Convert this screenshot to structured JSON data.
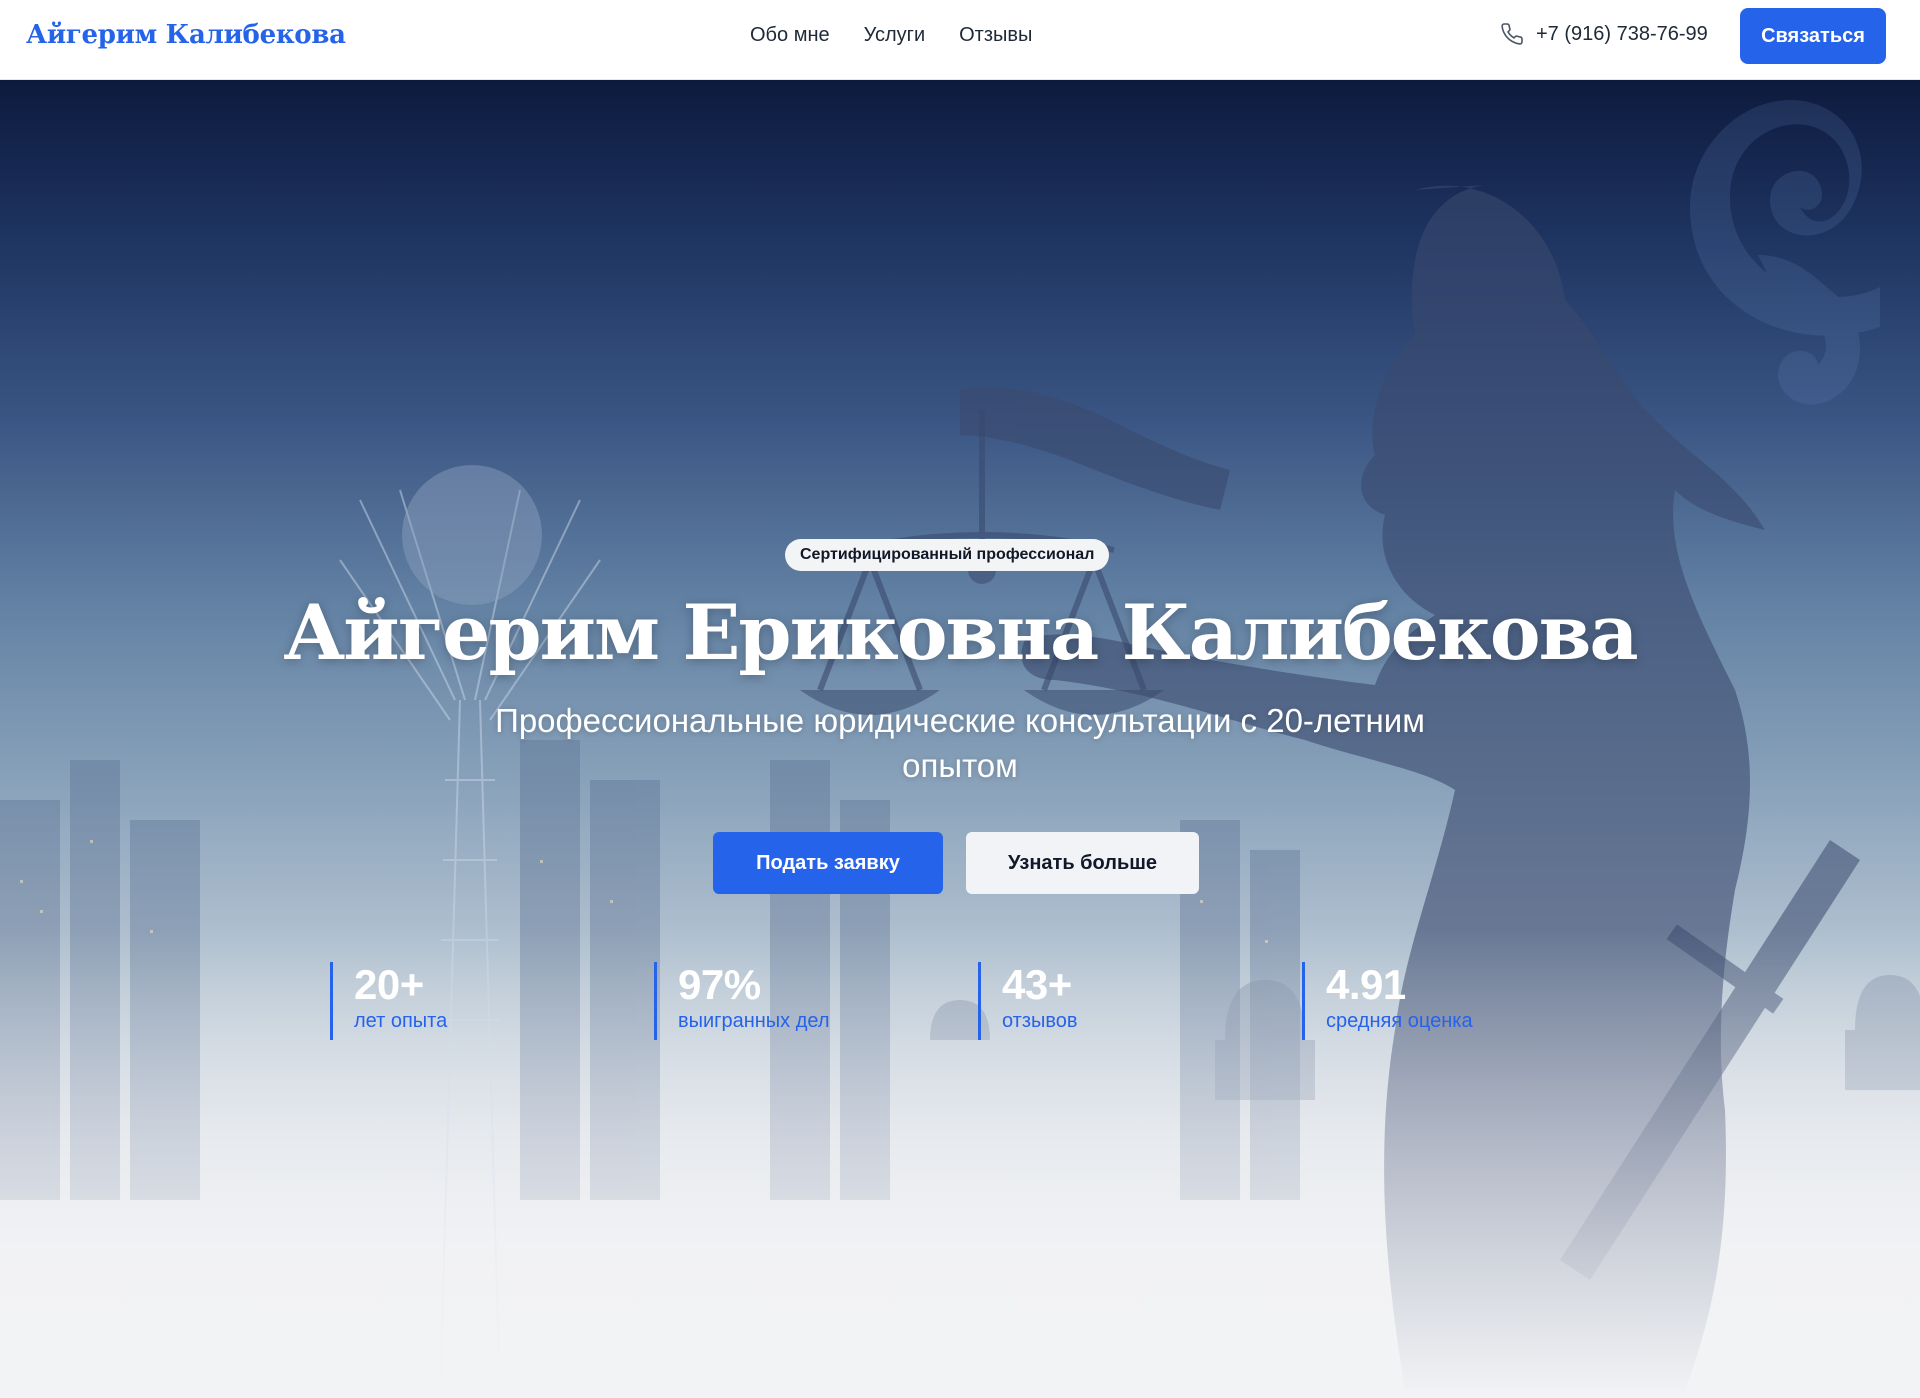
{
  "header": {
    "logo": "Айгерим Калибекова",
    "nav": [
      "Обо мне",
      "Услуги",
      "Отзывы"
    ],
    "phone": "+7 (916) 738-76-99",
    "phone_icon": "phone-icon",
    "contact_button": "Связаться"
  },
  "hero": {
    "badge": "Сертифицированный профессионал",
    "title": "Айгерим Ериковна Калибекова",
    "subtitle": "Профессиональные юридические консультации с 20-летним опытом",
    "primary_button": "Подать заявку",
    "secondary_button": "Узнать больше",
    "stats": [
      {
        "value": "20+",
        "label": "лет опыта"
      },
      {
        "value": "97%",
        "label": "выигранных дел"
      },
      {
        "value": "43+",
        "label": "отзывов"
      },
      {
        "value": "4.91",
        "label": "средняя оценка"
      }
    ]
  },
  "colors": {
    "accent": "#2563eb",
    "header_bg": "#ffffff",
    "hero_top": "#0d1a3d",
    "hero_bottom": "#f2f3f5"
  }
}
